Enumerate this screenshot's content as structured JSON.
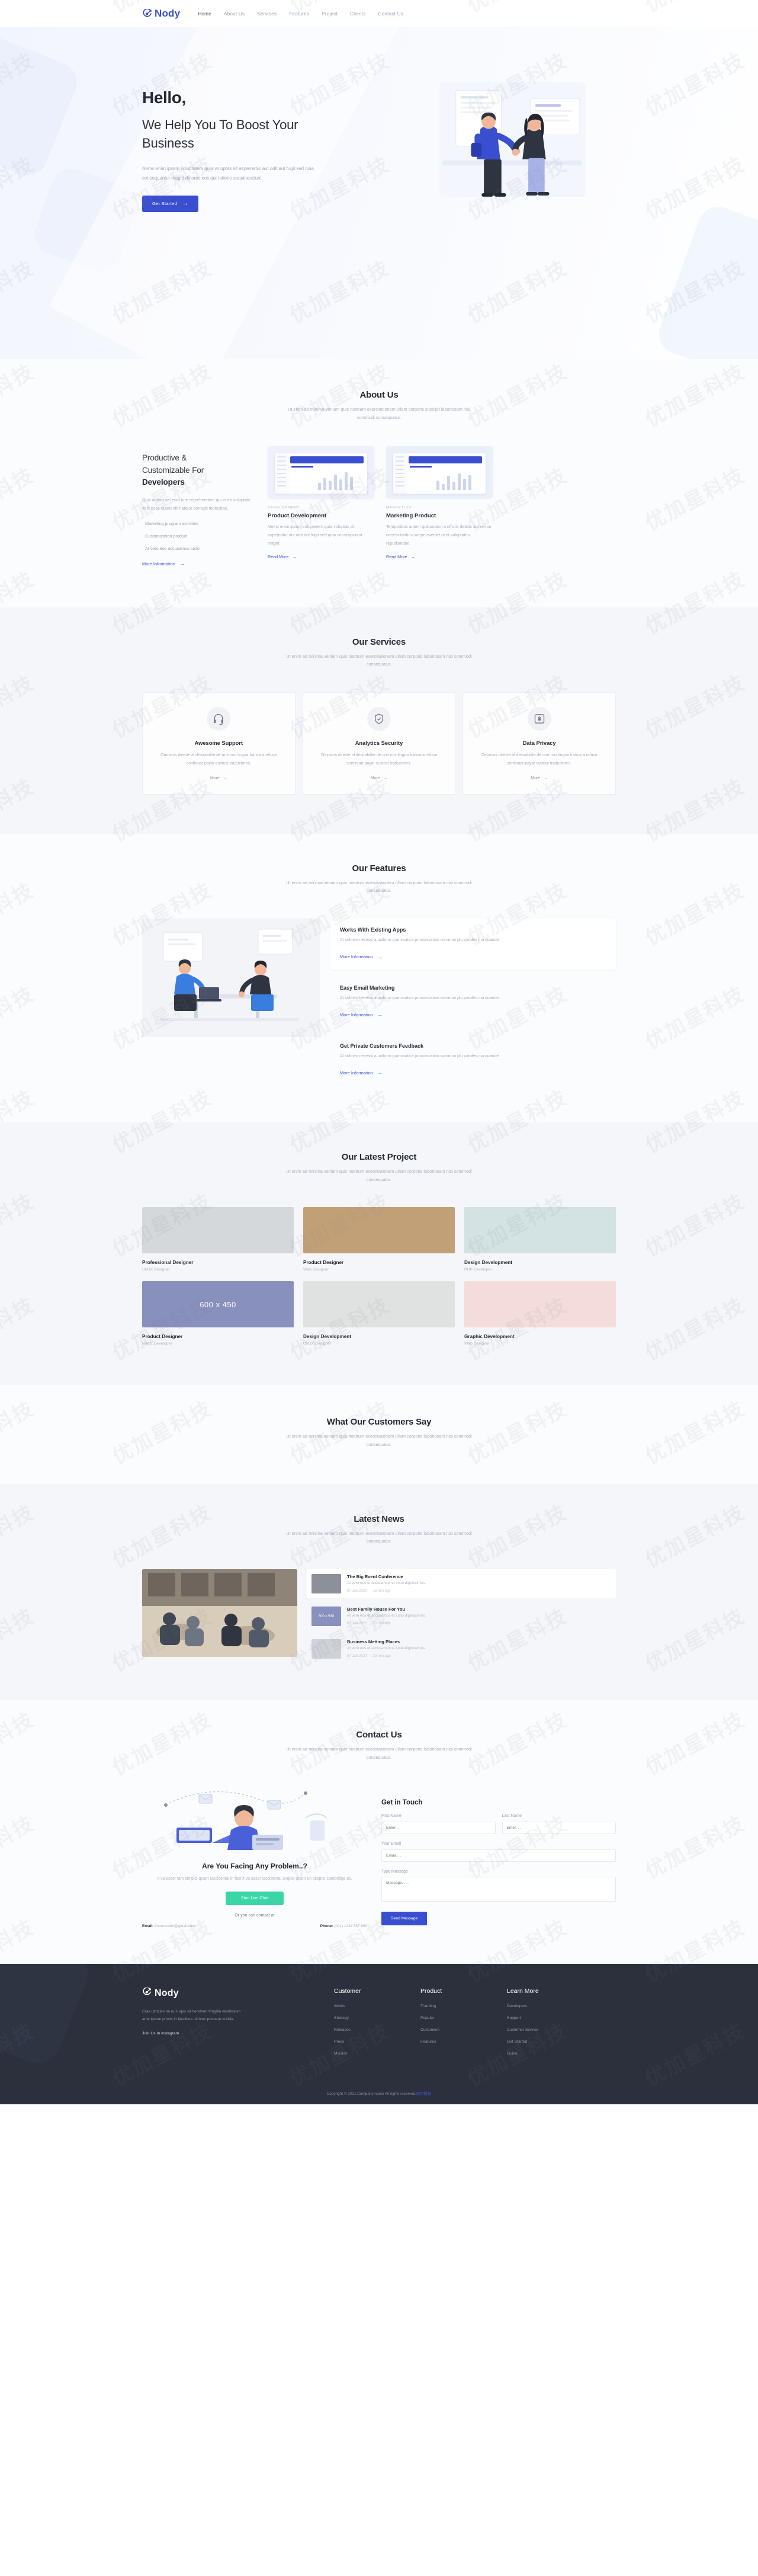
{
  "brand": {
    "name": "Nody",
    "mark": "target-arrow-icon"
  },
  "nav": {
    "items": [
      {
        "label": "Home",
        "active": true
      },
      {
        "label": "About Us",
        "active": false
      },
      {
        "label": "Services",
        "active": false
      },
      {
        "label": "Features",
        "active": false
      },
      {
        "label": "Project",
        "active": false
      },
      {
        "label": "Clients",
        "active": false
      },
      {
        "label": "Contact Us",
        "active": false
      }
    ]
  },
  "hero": {
    "hello": "Hello,",
    "heading": "We Help You To Boost Your Business",
    "paragraph": "Nemo enim ipsam voluptatem quia voluptas sit aspernatur aut odit aut fugit.sed quia consequuntur magni dolores eos qui ratione sequinesciunt.",
    "cta": "Get Started",
    "cta_arrow": "→"
  },
  "about": {
    "title": "About Us",
    "subtitle": "Ut enim ad minima veniam quis nostrum exercitationem ullam corporis suscipit laboriosam nisi commodi consequatur.",
    "heading_line1": "Productive &",
    "heading_line2": "Customizable For",
    "heading_bold": "Developers",
    "paragraph": "Quis autem vel eum iure reprehenderit qui in ea voluptate velit esse quam nihil atque corrupti molestiae.",
    "list": [
      "Marketing program activities",
      "Customization product",
      "At vero eos accusamus iusto"
    ],
    "more_link": "More Information",
    "arrow": "→",
    "cards": [
      {
        "kicker": "DEVELOPMENT",
        "title": "Product Development",
        "paragraph": "Nemo enim ipsam voluptatem quia voluptas sit aspernatur aut odit aut fugit sed quia consequuntur magni.",
        "link": "Read More"
      },
      {
        "kicker": "MARKETING",
        "title": "Marketing Product",
        "paragraph": "Temporibus autem quibusdam a officiis debitis aut rerum necessitatibus saepe eveniet ut et voluptates repudiandae.",
        "link": "Read More"
      }
    ]
  },
  "services": {
    "title": "Our Services",
    "subtitle": "Ut enim ad minima veniam quis nostrum exercitationem ullam corporis laboriosam nisi commodi consequatur.",
    "more_label": "More",
    "arrow": "→",
    "cards": [
      {
        "icon": "headset-icon",
        "title": "Awesome Support",
        "paragraph": "Omnicos directe al desirabilite de une nov lingua franca a refusa continuar payar custosi traductores."
      },
      {
        "icon": "shield-check-icon",
        "title": "Analytics Security",
        "paragraph": "Omnicos directe al desirabilite de une nov lingua franca a refusa continuar payar custosi traductores."
      },
      {
        "icon": "lock-screen-icon",
        "title": "Data Privacy",
        "paragraph": "Omnicos directe al desirabilite de une nov lingua franca a refusa continuar payar custosi traductores."
      }
    ]
  },
  "features": {
    "title": "Our Features",
    "subtitle": "Ut enim ad minima veniam quis nostrum exercitationem ullam corporis laboriosam nisi commodi consequatur.",
    "link": "More Information",
    "arrow": "→",
    "items": [
      {
        "title": "Works With Existing Apps",
        "paragraph": "At solmen necessi a uniform grammatica pronunciation sommun plu paroles ma quande."
      },
      {
        "title": "Easy Email Marketing",
        "paragraph": "At solmen necessi a uniform grammatica pronunciation sommun plu paroles ma quande."
      },
      {
        "title": "Get Private Customers Feedback",
        "paragraph": "At solmen necessi a uniform grammatica pronunciation sommun plu paroles ma quande."
      }
    ]
  },
  "projects": {
    "title": "Our Latest Project",
    "subtitle": "Ut enim ad minima veniam quis nostrum exercitationem ullam corporis laboriosam nisi commodi consequatur.",
    "items": [
      {
        "name": "Professional Designer",
        "role": "UI/UX Designer",
        "color": "#d5d8da",
        "placeholder": ""
      },
      {
        "name": "Product Designer",
        "role": "Web Designer",
        "color": "#c2a077",
        "placeholder": ""
      },
      {
        "name": "Design Development",
        "role": "PHP Developer",
        "color": "#d3e2e2",
        "placeholder": ""
      },
      {
        "name": "Product Designer",
        "role": "React Developer",
        "color": "#8890bd",
        "placeholder": "600 x 450"
      },
      {
        "name": "Design Development",
        "role": "UI/UX Designer",
        "color": "#dfe2e0",
        "placeholder": ""
      },
      {
        "name": "Graphic Development",
        "role": "Web Designer",
        "color": "#f3dcd9",
        "placeholder": ""
      }
    ]
  },
  "customers": {
    "title": "What Our Customers Say",
    "subtitle": "Ut enim ad minima veniam quis nostrum exercitationem ullam corporis laboriosam nisi commodi consequatur."
  },
  "news": {
    "title": "Latest News",
    "subtitle": "Ut enim ad minima veniam quis nostrum exercitationem ullam corporis laboriosam nisi commodi consequatur.",
    "items": [
      {
        "title": "The Big Event Conference",
        "paragraph": "At vero eos et accusamus et iusto dignissimos.",
        "date": "07 Jan 2020",
        "ago": "15 min ago",
        "placeholder": "",
        "color": "#8c9099"
      },
      {
        "title": "Best Family House For You",
        "paragraph": "At vero eos et accusamus et iusto dignissimos.",
        "date": "07 Jan 2020",
        "ago": "20 min ago",
        "placeholder": "800 x 530",
        "color": "#8890bd"
      },
      {
        "title": "Business Metting Places",
        "paragraph": "At vero eos et accusamus et iusto dignissimos.",
        "date": "07 Jan 2020",
        "ago": "30 min ago",
        "placeholder": "",
        "color": "#cfd3d8"
      }
    ]
  },
  "contact": {
    "title": "Contact Us",
    "subtitle": "Ut enim ad minima veniam quis nostrum exercitationem ullam corporis laboriosam nisi commodi consequatur.",
    "cta_heading": "Are You Facing Any Problem..?",
    "cta_paragraph": "It va esser tam simplic quam Occidental in fact it va esser Occidental angles quam un skeptic cambridge es.",
    "chat_button": "Start Live Chat",
    "or_text": "Or you can contact at",
    "email_label": "Email:",
    "email_value": "Youremailid@gmail.com",
    "phone_label": "Phone:",
    "phone_value": "(001) 1234 567 890",
    "form": {
      "heading": "Get in Touch",
      "first_name_label": "First Name",
      "first_name_placeholder": "Enter. . .",
      "last_name_label": "Last Name",
      "last_name_placeholder": "Enter. . .",
      "email_label": "Your Email",
      "email_placeholder": "Email. . .",
      "message_label": "Type Massage",
      "message_placeholder": "Message. . . .",
      "submit": "Send Message"
    }
  },
  "footer": {
    "brand": "Nody",
    "paragraph": "Cras ultricies mi eu turpis sit hendrerit fringilla vestibulum ante ipsum primis in faucibus ultrices posuere cubilia.",
    "instagram": "Join Us In Instagram",
    "columns": [
      {
        "heading": "Customer",
        "links": [
          "Works",
          "Strategy",
          "Releases",
          "Press",
          "Mission"
        ]
      },
      {
        "heading": "Product",
        "links": [
          "Tranding",
          "Popular",
          "Customers",
          "Features"
        ]
      },
      {
        "heading": "Learn More",
        "links": [
          "Developers",
          "Support",
          "Customer Service",
          "Get Started",
          "Guide"
        ]
      }
    ],
    "copyright": "Copyright © 2021.Company name All rights reserved.",
    "copyright_link": "网页模板"
  },
  "colors": {
    "accent": "#3a4fd0",
    "accent_light": "#3f55d6",
    "green": "#3ad6a8",
    "footer_bg": "#2b303c",
    "muted": "#a9aebb"
  },
  "watermark": "优加星科技"
}
